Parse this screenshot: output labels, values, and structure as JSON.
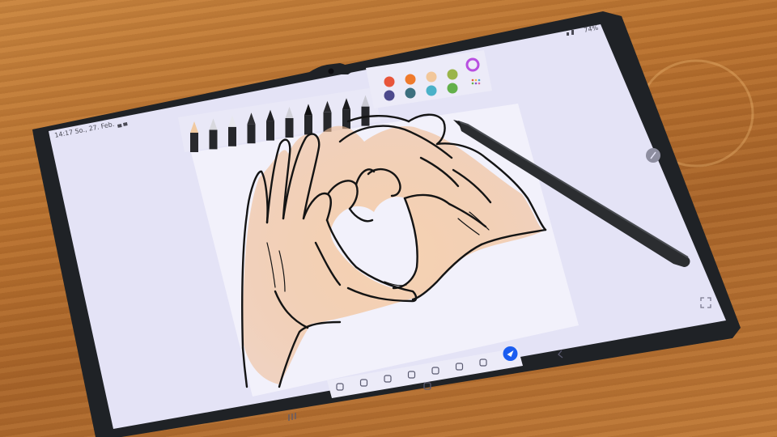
{
  "status_bar": {
    "left_text": "14:17 So., 27. Feb.",
    "right_text": "74%"
  },
  "colors": {
    "wood": "#b8712f",
    "screen": "#e4e3f6",
    "bezel": "#1f2226",
    "skin_tint": "#f3c9a6",
    "pen_body": "#2b2d30",
    "send_button": "#1a5cf0"
  },
  "pen_tools": [
    "pencil-tool",
    "brush-tool",
    "crayon-tool",
    "marker-tool",
    "fineliner-tool",
    "calligraphy-tool",
    "fountain-pen-tool",
    "airbrush-tool",
    "spray-tool",
    "pastel-tool"
  ],
  "palette": [
    "#e8553a",
    "#ef7a2c",
    "#f2c79a",
    "#9ab54a",
    "#4d4a8c",
    "#3c6f7e",
    "#4ab1c8",
    "#63b04a"
  ],
  "bottom_toolbar_icons": [
    "eraser-icon",
    "undo-icon",
    "redo-icon",
    "lasso-icon",
    "layers-icon",
    "save-icon",
    "settings-icon",
    "send-icon"
  ],
  "nav_bar_icons": [
    "recent-apps-icon",
    "home-icon",
    "back-icon"
  ]
}
